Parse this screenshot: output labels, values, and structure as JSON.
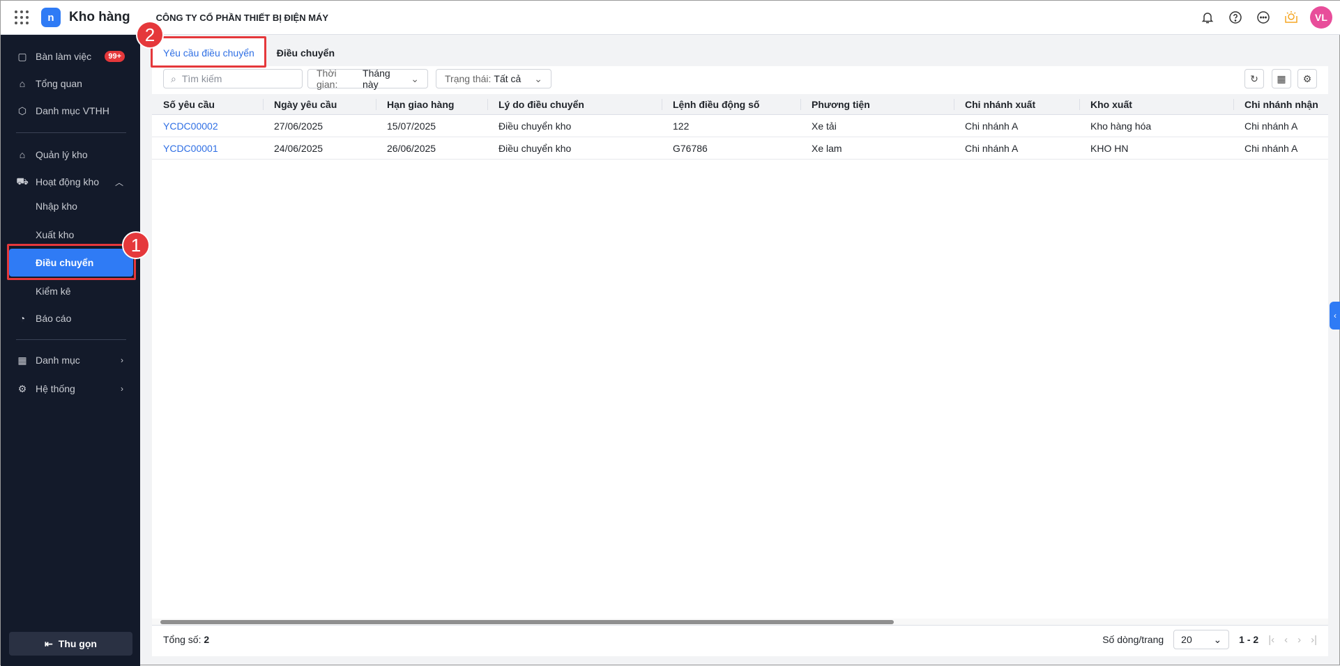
{
  "header": {
    "app_name": "Kho hàng",
    "logo_text": "n",
    "company": "CÔNG TY CỔ PHẦN THIẾT BỊ ĐIỆN MÁY",
    "avatar": "VL"
  },
  "sidebar": {
    "items": [
      {
        "label": "Bàn làm việc",
        "badge": "99+"
      },
      {
        "label": "Tổng quan"
      },
      {
        "label": "Danh mục VTHH"
      },
      {
        "label": "Quản lý kho"
      },
      {
        "label": "Hoạt động kho"
      },
      {
        "label": "Nhập kho"
      },
      {
        "label": "Xuất kho"
      },
      {
        "label": "Điều chuyển"
      },
      {
        "label": "Kiểm kê"
      },
      {
        "label": "Báo cáo"
      },
      {
        "label": "Danh mục"
      },
      {
        "label": "Hệ thống"
      }
    ],
    "collapse_label": "Thu gọn"
  },
  "tabs": [
    {
      "label": "Yêu cầu điều chuyển"
    },
    {
      "label": "Điều chuyển"
    }
  ],
  "toolbar": {
    "search_placeholder": "Tìm kiếm",
    "time_label": "Thời gian:",
    "time_value": "Tháng này",
    "status_label": "Trạng thái:",
    "status_value": "Tất cả"
  },
  "table": {
    "columns": [
      "Số yêu cầu",
      "Ngày yêu cầu",
      "Hạn giao hàng",
      "Lý do điều chuyển",
      "Lệnh điều động số",
      "Phương tiện",
      "Chi nhánh xuất",
      "Kho xuất",
      "Chi nhánh nhận"
    ],
    "rows": [
      [
        "YCDC00002",
        "27/06/2025",
        "15/07/2025",
        "Điều chuyển kho",
        "122",
        "Xe tải",
        "Chi nhánh A",
        "Kho hàng hóa",
        "Chi nhánh A"
      ],
      [
        "YCDC00001",
        "24/06/2025",
        "26/06/2025",
        "Điều chuyển kho",
        "G76786",
        "Xe lam",
        "Chi nhánh A",
        "KHO HN",
        "Chi nhánh A"
      ]
    ]
  },
  "footer": {
    "total_label": "Tổng số:",
    "total": "2",
    "rows_per_page_label": "Số dòng/trang",
    "rows_per_page": "20",
    "range": "1 - 2"
  },
  "annotations": [
    "1",
    "2"
  ]
}
